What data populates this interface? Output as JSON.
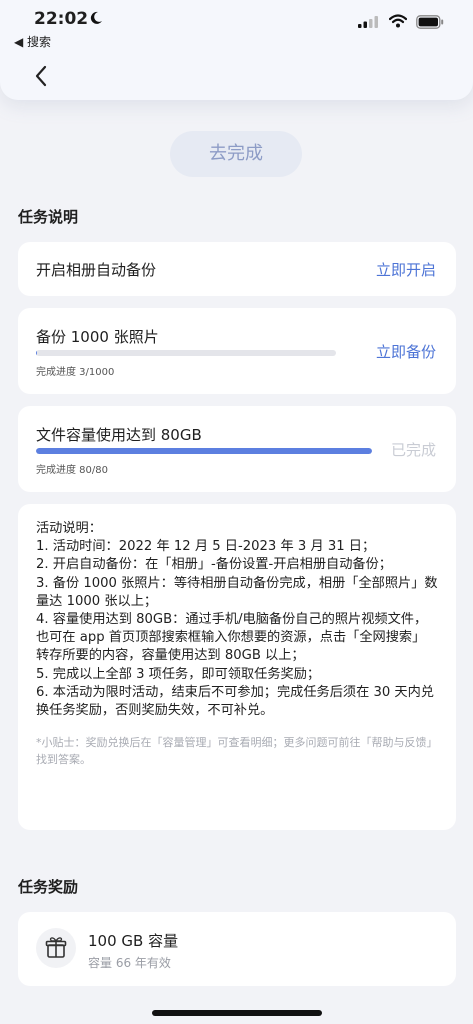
{
  "status_bar": {
    "time": "22:02",
    "back_app_label": "◀ 搜索",
    "icons": [
      "moon-icon",
      "signal-icon",
      "wifi-icon",
      "battery-icon"
    ]
  },
  "nav": {
    "back_icon": "chevron-left-icon"
  },
  "go_complete_button": "去完成",
  "task_section": {
    "title": "任务说明",
    "tasks": [
      {
        "label": "开启相册自动备份",
        "action": "立即开启"
      },
      {
        "label": "备份 1000 张照片",
        "action": "立即备份",
        "progress_text": "完成进度 3/1000",
        "progress": 0.003
      },
      {
        "label": "文件容量使用达到 80GB",
        "action": "已完成",
        "progress_text": "完成进度 80/80",
        "progress": 1.0
      }
    ]
  },
  "activity_description": {
    "lines": [
      "活动说明：",
      "1. 活动时间：2022 年 12 月 5 日-2023 年 3 月 31 日；",
      "2. 开启自动备份：在「相册」-备份设置-开启相册自动备份；",
      "3. 备份 1000 张照片：等待相册自动备份完成，相册「全部照片」数量达 1000 张以上；",
      "4. 容量使用达到 80GB：通过手机/电脑备份自己的照片视频文件，也可在 app 首页顶部搜索框输入你想要的资源，点击「全网搜索」转存所要的内容，容量使用达到 80GB 以上；",
      "5. 完成以上全部 3 项任务，即可领取任务奖励；",
      "6. 本活动为限时活动，结束后不可参加；完成任务后须在 30 天内兑换任务奖励，否则奖励失效，不可补兑。"
    ],
    "tip": "*小贴士：奖励兑换后在「容量管理」可查看明细；更多问题可前往「帮助与反馈」找到答案。"
  },
  "reward_section": {
    "title": "任务奖励",
    "reward_icon": "gift-icon",
    "reward_title": "100 GB 容量",
    "reward_sub": "容量 66 年有效"
  },
  "colors": {
    "accent": "#4d74d6",
    "progress": "#5c7fe0",
    "background": "#f2f3f7",
    "done_text": "#c9ccd4"
  }
}
